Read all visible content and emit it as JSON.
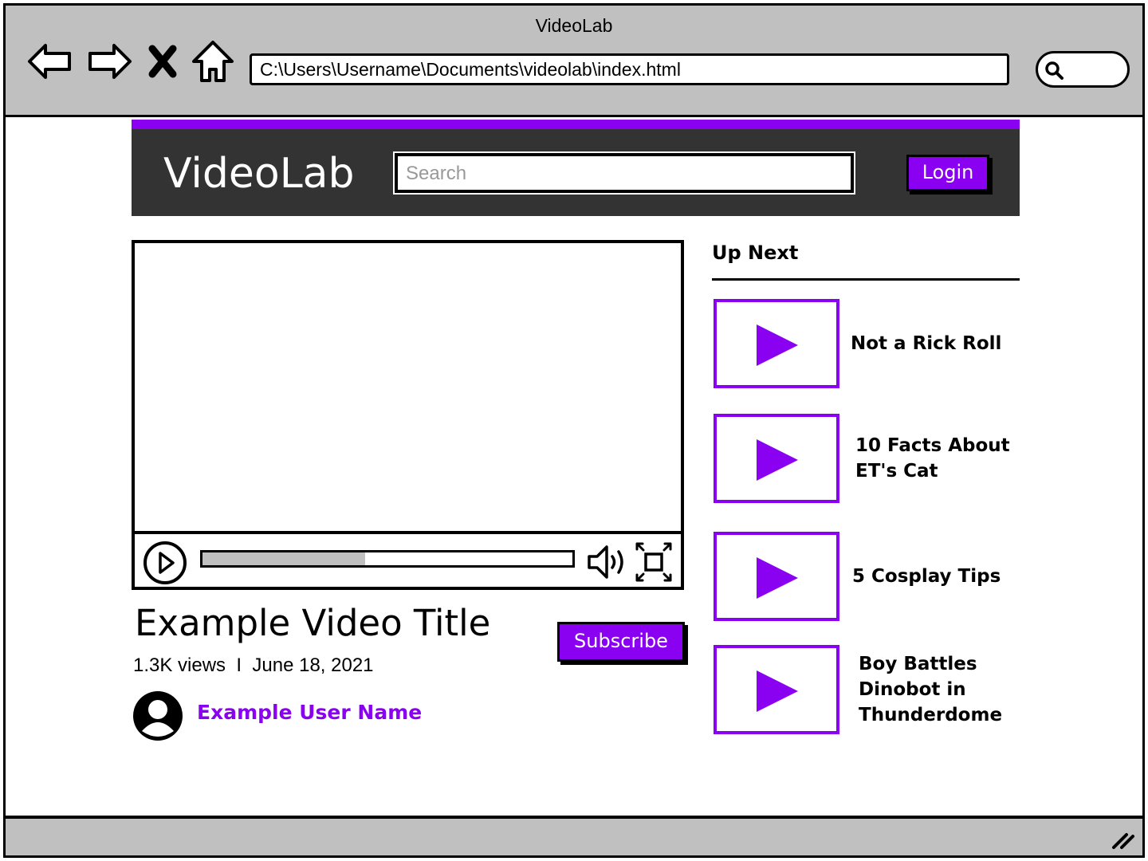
{
  "window": {
    "title": "VideoLab",
    "address": "C:\\Users\\Username\\Documents\\videolab\\index.html"
  },
  "icons": [
    "back-arrow-icon",
    "forward-arrow-icon",
    "stop-icon",
    "home-icon",
    "search-icon",
    "play-icon",
    "volume-icon",
    "fullscreen-icon",
    "user-avatar-icon",
    "resize-grip-icon"
  ],
  "colors": {
    "accent": "#8a00f0",
    "header_bg": "#333333",
    "chrome": "#c0c0c0"
  },
  "site": {
    "logo": "VideoLab",
    "search_placeholder": "Search",
    "login_label": "Login"
  },
  "player": {
    "progress_fraction": 0.44
  },
  "video": {
    "title": "Example Video Title",
    "meta": "1.3K views  I  June 18, 2021",
    "subscribe_label": "Subscribe",
    "user_name": "Example User Name"
  },
  "up_next": {
    "heading": "Up Next",
    "items": [
      {
        "title": "Not a Rick Roll"
      },
      {
        "title": "10 Facts About\nET's Cat"
      },
      {
        "title": "5 Cosplay Tips"
      },
      {
        "title": "Boy Battles\nDinobot in\nThunderdome"
      }
    ]
  }
}
